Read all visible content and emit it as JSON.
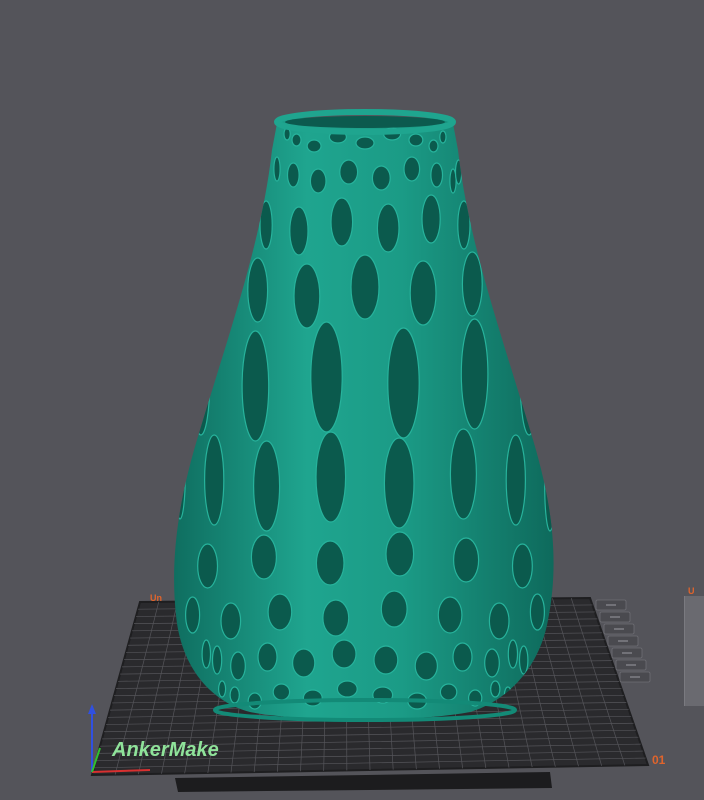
{
  "plate": {
    "brand_logo": "AnkerMake",
    "plate_number": "01",
    "plate_name_truncated": "Un",
    "next_plate_name_truncated": "U"
  },
  "model": {
    "object": "voronoi-vase",
    "color": "#1b9b86"
  },
  "colors": {
    "background": "#54545a",
    "plate": "#303033",
    "grid": "#5a5a5e",
    "logo": "#8fe39a",
    "accent_label": "#e0642c",
    "axis_x": "#d83030",
    "axis_y": "#30c030",
    "axis_z": "#3050e0"
  },
  "plate_tools": [
    {
      "name": "arrange-icon"
    },
    {
      "name": "orient-icon"
    },
    {
      "name": "slice-plate-icon"
    },
    {
      "name": "plate-settings-icon"
    },
    {
      "name": "lock-plate-icon"
    },
    {
      "name": "delete-plate-icon"
    },
    {
      "name": "plate-menu-icon"
    }
  ]
}
